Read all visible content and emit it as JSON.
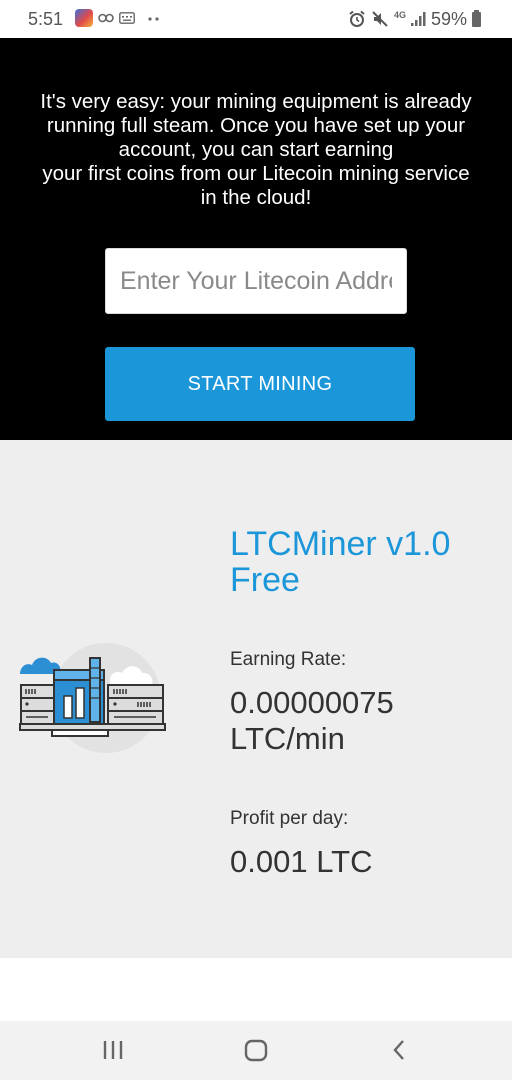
{
  "status_bar": {
    "time": "5:51",
    "battery_percent": "59%",
    "network": "4G",
    "icons": [
      "app-icon",
      "link-icon",
      "keyboard-icon",
      "more-dots-icon",
      "alarm-icon",
      "mute-icon",
      "network-4g-icon",
      "signal-icon",
      "battery-icon"
    ]
  },
  "hero": {
    "lines": [
      "It's very easy: your mining equipment is already",
      "running full steam. Once you have set up your",
      "account, you can start earning",
      "your first coins from our Litecoin mining service",
      "in the cloud!"
    ],
    "address_placeholder": "Enter Your Litecoin Address",
    "address_value": "",
    "start_button_label": "START MINING"
  },
  "info": {
    "product_title": "LTCMiner v1.0 Free",
    "earning_rate_label": "Earning Rate:",
    "earning_rate_value": "0.00000075 LTC/min",
    "profit_label": "Profit per day:",
    "profit_value": "0.001 LTC",
    "illustration_icon": "mining-servers-illustration"
  },
  "nav": {
    "icons": [
      "recent-apps-icon",
      "home-icon",
      "back-icon"
    ]
  },
  "colors": {
    "accent": "#1b96d9",
    "hero_bg": "#000000",
    "panel_bg": "#eeeeee",
    "nav_bg": "#f2f2f2",
    "text_dark": "#333333"
  }
}
